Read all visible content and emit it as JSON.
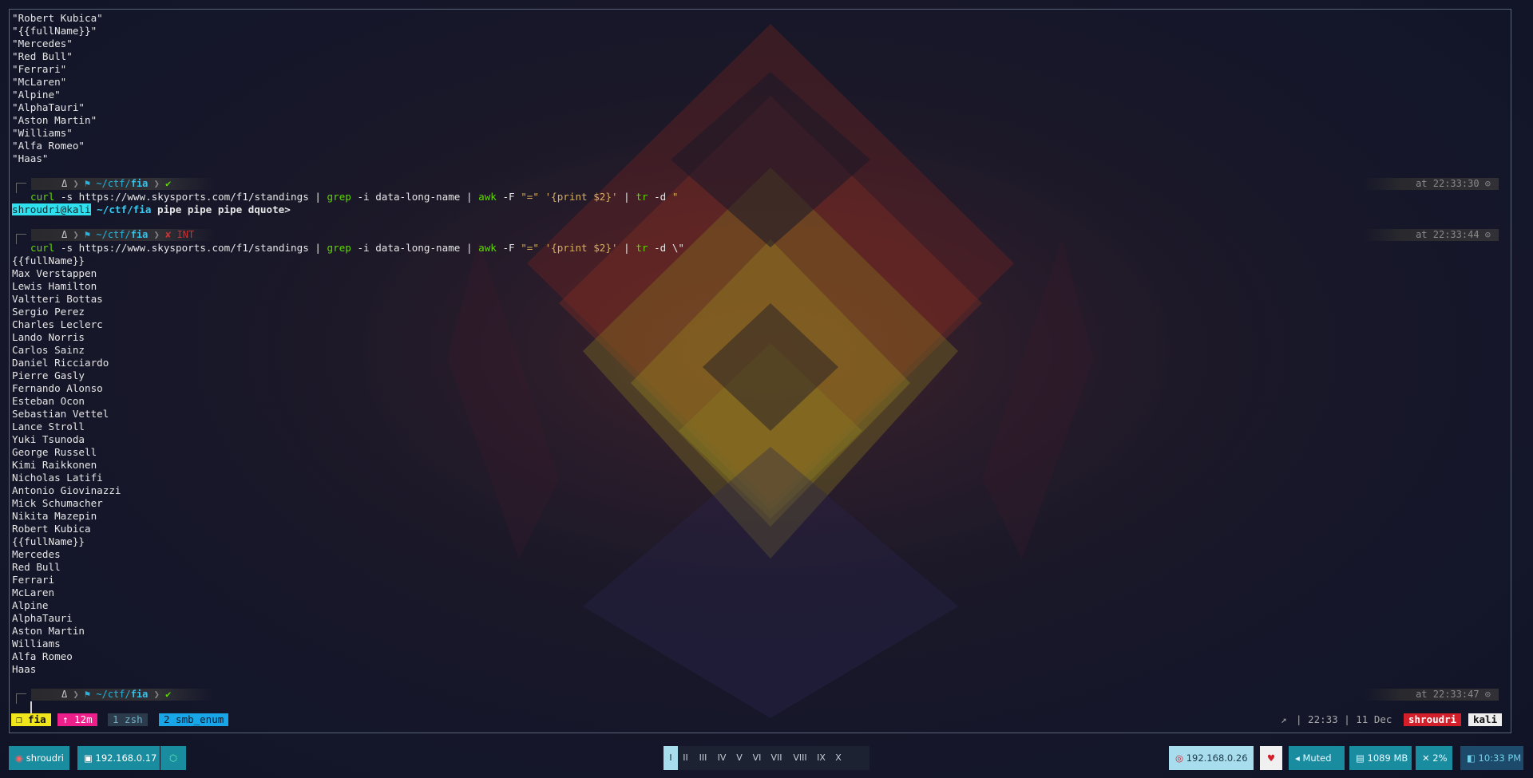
{
  "terminal": {
    "output_top": [
      "\"Robert Kubica\"",
      "\"{{fullName}}\"",
      "\"Mercedes\"",
      "\"Red Bull\"",
      "\"Ferrari\"",
      "\"McLaren\"",
      "\"Alpine\"",
      "\"AlphaTauri\"",
      "\"Aston Martin\"",
      "\"Williams\"",
      "\"Alfa Romeo\"",
      "\"Haas\""
    ],
    "prompt1": {
      "dir_prefix": "~/ctf/",
      "dir": "fia",
      "status": "✔",
      "time": "at 22:33:30 ⊙"
    },
    "cmd1": {
      "cmd": "curl",
      "p1": " -s https://www.skysports.com/f1/standings | ",
      "grep": "grep",
      "p2": " -i data-long-name | ",
      "awk": "awk",
      "p3": " -F ",
      "s1": "\"=\"",
      "p4": " ",
      "s2": "'{print $2}'",
      "p5": " | ",
      "tr": "tr",
      "p6": " -d ",
      "s3": "\""
    },
    "dquote": {
      "user": "shroudri@kali",
      "path": "~/ctf/fia",
      "rest": " pipe pipe pipe dquote>"
    },
    "prompt2": {
      "dir_prefix": "~/ctf/",
      "dir": "fia",
      "status": "✘ INT",
      "time": "at 22:33:44 ⊙"
    },
    "cmd2": {
      "cmd": "curl",
      "p1": " -s https://www.skysports.com/f1/standings | ",
      "grep": "grep",
      "p2": " -i data-long-name | ",
      "awk": "awk",
      "p3": " -F ",
      "s1": "\"=\"",
      "p4": " ",
      "s2": "'{print $2}'",
      "p5": " | ",
      "tr": "tr",
      "p6": " -d \\\""
    },
    "output_bottom": [
      "{{fullName}}",
      "Max Verstappen",
      "Lewis Hamilton",
      "Valtteri Bottas",
      "Sergio Perez",
      "Charles Leclerc",
      "Lando Norris",
      "Carlos Sainz",
      "Daniel Ricciardo",
      "Pierre Gasly",
      "Fernando Alonso",
      "Esteban Ocon",
      "Sebastian Vettel",
      "Lance Stroll",
      "Yuki Tsunoda",
      "George Russell",
      "Kimi Raikkonen",
      "Nicholas Latifi",
      "Antonio Giovinazzi",
      "Mick Schumacher",
      "Nikita Mazepin",
      "Robert Kubica",
      "{{fullName}}",
      "Mercedes",
      "Red Bull",
      "Ferrari",
      "McLaren",
      "Alpine",
      "AlphaTauri",
      "Aston Martin",
      "Williams",
      "Alfa Romeo",
      "Haas"
    ],
    "prompt3": {
      "dir_prefix": "~/ctf/",
      "dir": "fia",
      "status": "✔",
      "time": "at 22:33:47 ⊙"
    }
  },
  "tmux": {
    "session": "❐ fia",
    "uptime": "↑ 12m",
    "window1": "1 zsh",
    "window2": "2 smb_enum",
    "arrow": "↗",
    "clock": "| 22:33 | 11 Dec",
    "user": "shroudri",
    "host": "kali"
  },
  "panel": {
    "user": "shroudri",
    "ip": "192.168.0.17",
    "cube": "⬡",
    "workspaces": [
      "I",
      "II",
      "III",
      "IV",
      "V",
      "VI",
      "VII",
      "VIII",
      "IX",
      "X"
    ],
    "remote_ip": "192.168.0.26",
    "heart": "♥",
    "volume": "Muted",
    "memory": "1089 MB",
    "cpu": "2%",
    "clock": "10:33 PM"
  },
  "colors": {
    "accent": "#1a8ca0",
    "active_ws": "#a8ddee",
    "tmux_session": "#f1e51b",
    "tmux_uptime": "#ee1f8a",
    "tmux_user": "#d21f2a"
  }
}
